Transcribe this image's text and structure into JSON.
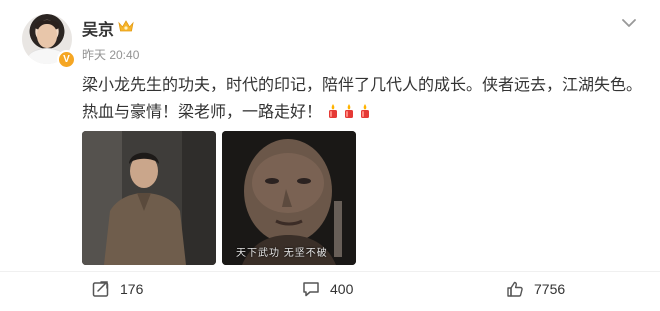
{
  "post": {
    "username": "吴京",
    "timestamp": "昨天 20:40",
    "text": "梁小龙先生的功夫，时代的印记，陪伴了几代人的成长。侠者远去，江湖失色。热血与豪情！梁老师，一路走好！",
    "emojis": [
      "candle-icon",
      "candle-icon",
      "candle-icon"
    ],
    "image2_caption": "天下武功 无坚不破"
  },
  "actions": {
    "repost_count": "176",
    "comment_count": "400",
    "like_count": "7756"
  },
  "colors": {
    "verify_badge": "#f5a623",
    "text": "#333333",
    "meta": "#939393"
  }
}
